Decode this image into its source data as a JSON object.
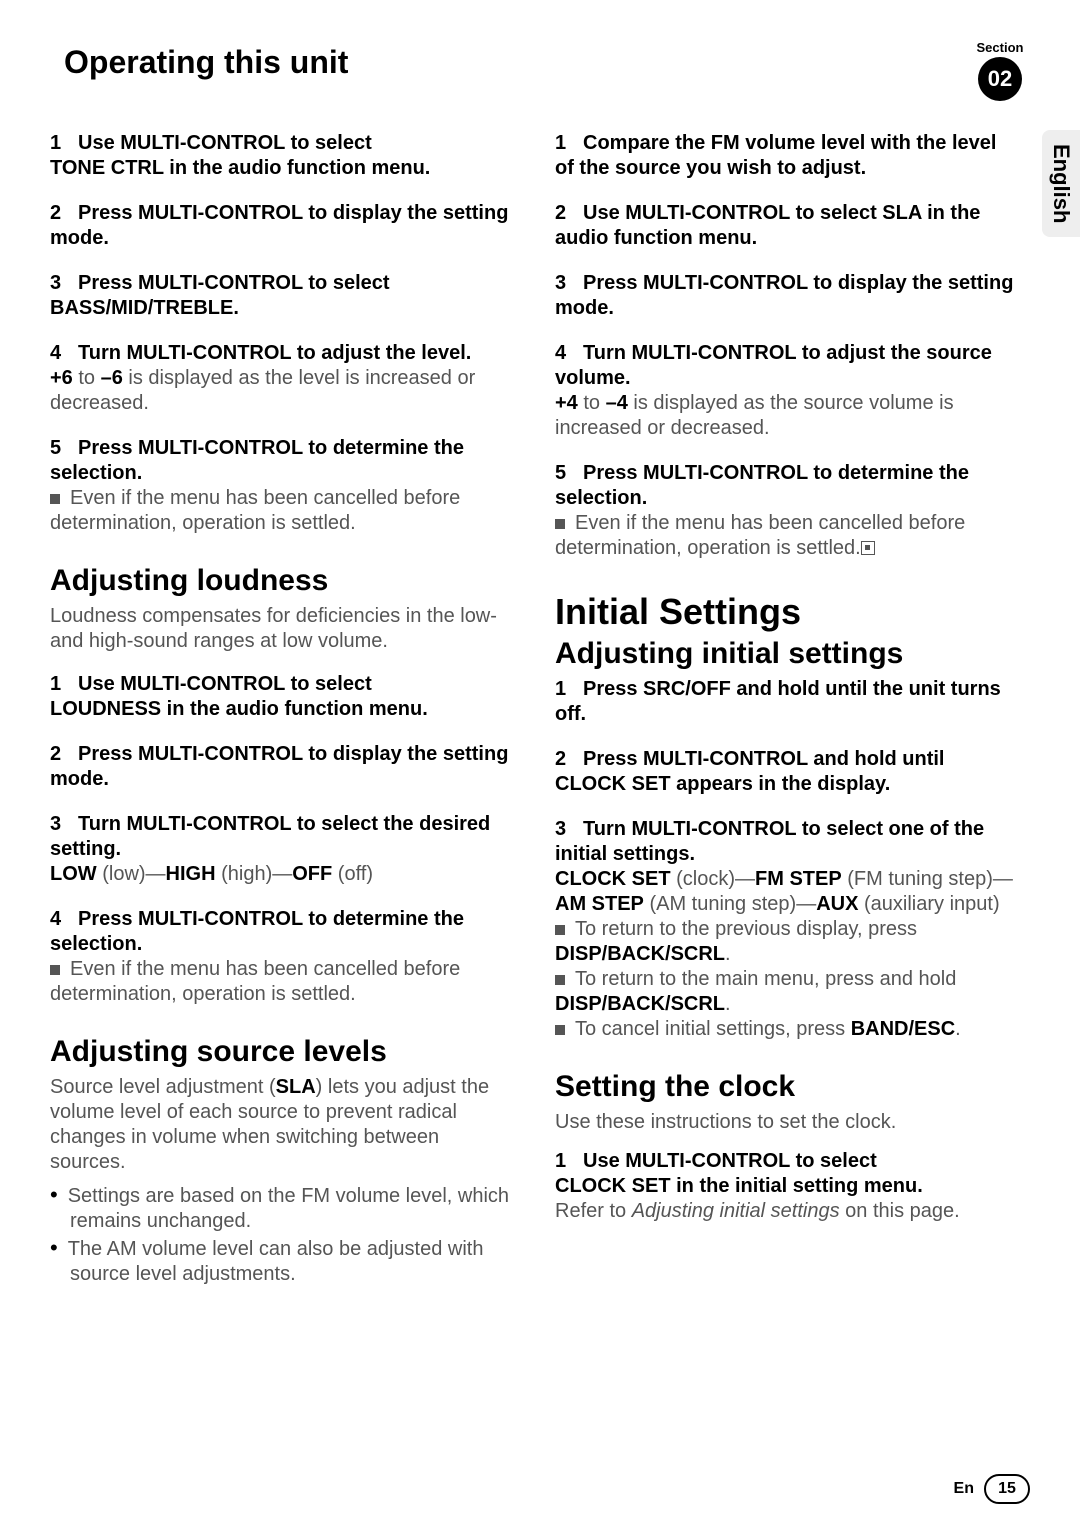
{
  "header": {
    "title": "Operating this unit",
    "section_label": "Section",
    "section_number": "02"
  },
  "sidetab": "English",
  "left": {
    "s1": {
      "n": "1",
      "b1": "Use MULTI-CONTROL to select",
      "b2": "TONE CTRL in the audio function menu."
    },
    "s2": {
      "n": "2",
      "b": "Press MULTI-CONTROL to display the setting mode."
    },
    "s3": {
      "n": "3",
      "b": "Press MULTI-CONTROL to select BASS/MID/TREBLE."
    },
    "s4": {
      "n": "4",
      "b": "Turn MULTI-CONTROL to adjust the level.",
      "body_pre": "",
      "plus": "+6",
      "to": " to ",
      "minus": "–6",
      "body_post": " is displayed as the level is increased or decreased."
    },
    "s5": {
      "n": "5",
      "b": "Press MULTI-CONTROL to determine the selection.",
      "note": "Even if the menu has been cancelled before determination, operation is settled."
    },
    "loudness": {
      "h": "Adjusting loudness",
      "intro": "Loudness compensates for deficiencies in the low- and high-sound ranges at low volume.",
      "s1": {
        "n": "1",
        "b1": "Use MULTI-CONTROL to select",
        "b2": "LOUDNESS in the audio function menu."
      },
      "s2": {
        "n": "2",
        "b": "Press MULTI-CONTROL to display the setting mode."
      },
      "s3": {
        "n": "3",
        "b": "Turn MULTI-CONTROL to select the desired setting.",
        "opts_pre": "",
        "low": "LOW",
        "low_p": " (low)—",
        "high": "HIGH",
        "high_p": " (high)—",
        "off": "OFF",
        "off_p": " (off)"
      },
      "s4": {
        "n": "4",
        "b": "Press MULTI-CONTROL to determine the selection.",
        "note": "Even if the menu has been cancelled before determination, operation is settled."
      }
    },
    "sla": {
      "h": "Adjusting source levels",
      "intro_pre": "Source level adjustment (",
      "intro_b": "SLA",
      "intro_post": ") lets you adjust the volume level of each source to prevent radical changes in volume when switching between sources.",
      "b1": "Settings are based on the FM volume level, which remains unchanged.",
      "b2": "The AM volume level can also be adjusted with source level adjustments."
    }
  },
  "right": {
    "s1": {
      "n": "1",
      "b": "Compare the FM volume level with the level of the source you wish to adjust."
    },
    "s2": {
      "n": "2",
      "b": "Use MULTI-CONTROL to select SLA in the audio function menu."
    },
    "s3": {
      "n": "3",
      "b": "Press MULTI-CONTROL to display the setting mode."
    },
    "s4": {
      "n": "4",
      "b": "Turn MULTI-CONTROL to adjust the source volume.",
      "plus": "+4",
      "to": " to ",
      "minus": "–4",
      "body_post": " is displayed as the source volume is increased or decreased."
    },
    "s5": {
      "n": "5",
      "b": "Press MULTI-CONTROL to determine the selection.",
      "note": "Even if the menu has been cancelled before determination, operation is settled."
    },
    "initial": {
      "h1": "Initial Settings",
      "h2": "Adjusting initial settings",
      "s1": {
        "n": "1",
        "b": "Press SRC/OFF and hold until the unit turns off."
      },
      "s2": {
        "n": "2",
        "b": "Press MULTI-CONTROL and hold until CLOCK SET appears in the display."
      },
      "s3": {
        "n": "3",
        "b": "Turn MULTI-CONTROL to select one of the initial settings.",
        "o1": "CLOCK SET",
        "o1p": " (clock)—",
        "o2": "FM STEP",
        "o2p": " (FM tuning step)—",
        "o3": "AM STEP",
        "o3p": " (AM tuning step)—",
        "o4": "AUX",
        "o4p": " (auxiliary input)",
        "n1_pre": "To return to the previous display, press ",
        "n1_b": "DISP/BACK/SCRL",
        "n1_post": ".",
        "n2_pre": "To return to the main menu, press and hold ",
        "n2_b": "DISP/BACK/SCRL",
        "n2_post": ".",
        "n3_pre": "To cancel initial settings, press ",
        "n3_b": "BAND/ESC",
        "n3_post": "."
      }
    },
    "clock": {
      "h": "Setting the clock",
      "intro": "Use these instructions to set the clock.",
      "s1": {
        "n": "1",
        "b1": "Use MULTI-CONTROL to select",
        "b2": "CLOCK SET in the initial setting menu.",
        "ref_pre": "Refer to ",
        "ref_i": "Adjusting initial settings",
        "ref_post": " on this page."
      }
    }
  },
  "footer": {
    "en": "En",
    "page": "15"
  }
}
